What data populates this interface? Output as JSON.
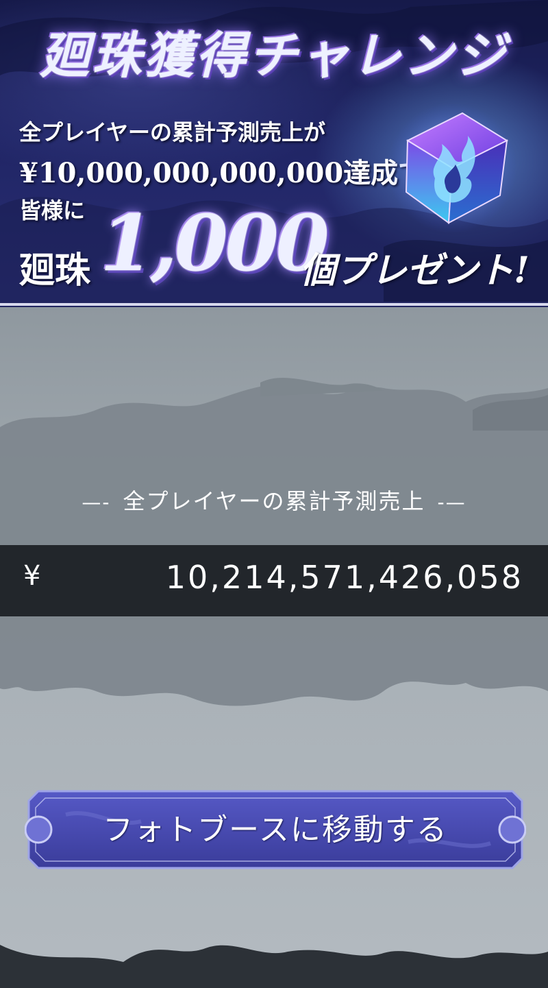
{
  "banner": {
    "title": "廻珠獲得チャレンジ",
    "line1": "全プレイヤーの累計予測売上が",
    "line2": "¥10,000,000,000,000達成で",
    "line3": "皆様に",
    "line4_prefix": "廻珠",
    "amount": "1,000",
    "line4_suffix": "個プレゼント!"
  },
  "stats": {
    "label": "全プレイヤーの累計予測売上",
    "dash_left": "—-",
    "dash_right": "-—",
    "currency": "¥",
    "value": "10,214,571,426,058"
  },
  "cta": {
    "label": "フォトブースに移動する"
  },
  "colors": {
    "banner_bg": "#202565",
    "counter_bg": "#22262b",
    "button_bg": "#4a4db4"
  }
}
